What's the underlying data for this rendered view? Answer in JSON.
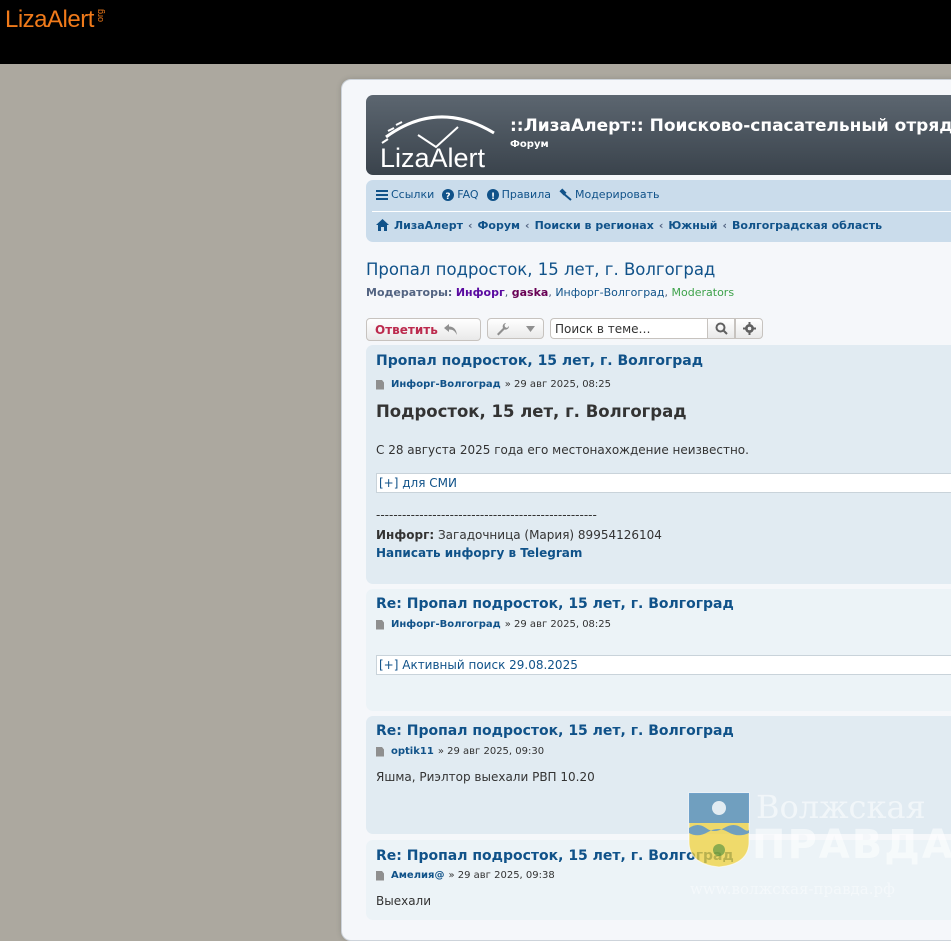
{
  "top_bar": {
    "logo_text": "LizaAlert",
    "logo_suffix": "org"
  },
  "header": {
    "logo_text": "LizaAlert",
    "site_title": "::ЛизаАлерт:: Поисково-спасательный отряд",
    "site_subtitle": "Форум"
  },
  "nav": {
    "links": [
      {
        "icon": "menu-icon",
        "label": "Ссылки"
      },
      {
        "icon": "question-icon",
        "label": "FAQ"
      },
      {
        "icon": "info-icon",
        "label": "Правила"
      },
      {
        "icon": "gavel-icon",
        "label": "Модерировать"
      }
    ],
    "breadcrumbs": [
      "ЛизаАлерт",
      "Форум",
      "Поиски в регионах",
      "Южный",
      "Волгоградская область"
    ]
  },
  "topic": {
    "title": "Пропал подросток, 15 лет, г. Волгоград",
    "moderators_label": "Модераторы:",
    "moderators": [
      "Инфорг",
      "gaska",
      "Инфорг-Волгоград",
      "Moderators"
    ]
  },
  "actions": {
    "reply_label": "Ответить",
    "search_placeholder": "Поиск в теме…"
  },
  "posts": [
    {
      "title": "Пропал подросток, 15 лет, г. Волгоград",
      "author": "Инфорг-Волгоград",
      "date": "» 29 авг 2025, 08:25",
      "heading": "Подросток, 15 лет, г. Волгоград",
      "text": "С 28 августа 2025 года его местонахождение неизвестно.",
      "spoiler": "[+] для СМИ",
      "divider": "---------------------------------------------------",
      "inforg_label": "Инфорг:",
      "inforg_value": "Загадочница (Мария) 89954126104",
      "link": "Написать инфоргу в Telegram"
    },
    {
      "title": "Re: Пропал подросток, 15 лет, г. Волгоград",
      "author": "Инфорг-Волгоград",
      "date": "» 29 авг 2025, 08:25",
      "spoiler": "[+] Активный поиск 29.08.2025"
    },
    {
      "title": "Re: Пропал подросток, 15 лет, г. Волгоград",
      "author": "optik11",
      "date": "» 29 авг 2025, 09:30",
      "text": "Яшма, Риэлтор выехали РВП 10.20"
    },
    {
      "title": "Re: Пропал подросток, 15 лет, г. Волгоград",
      "author": "Амелия@",
      "date": "» 29 авг 2025, 09:38",
      "text": "Выехали"
    }
  ],
  "watermark": {
    "line1": "Волжская",
    "line2": "ПРАВДА",
    "url": "www.волжская-правда.рф"
  },
  "colors": {
    "brand_orange": "#f07a1a",
    "link_blue": "#105289",
    "reply_red": "#bc2a4d",
    "post_bg1": "#e1ebf2",
    "post_bg2": "#ecf3f7"
  }
}
